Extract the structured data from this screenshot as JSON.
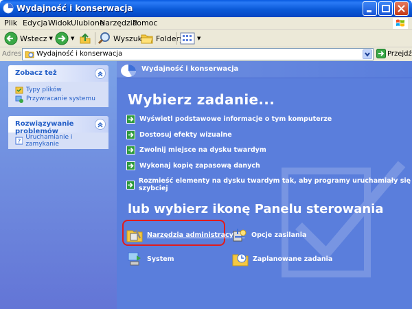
{
  "window": {
    "title": "Wydajność i konserwacja"
  },
  "menu": [
    "Plik",
    "Edycja",
    "Widok",
    "Ulubione",
    "Narzędzia",
    "Pomoc"
  ],
  "toolbar": {
    "back_label": "Wstecz",
    "search_label": "Wyszukaj",
    "folders_label": "Foldery"
  },
  "address": {
    "label": "Adres",
    "value": "Wydajność i konserwacja",
    "go_label": "Przejdź"
  },
  "sidebar": {
    "see_also": {
      "title": "Zobacz też",
      "links": [
        "Typy plików",
        "Przywracanie systemu"
      ]
    },
    "troubleshoot": {
      "title": "Rozwiązywanie problemów",
      "links": [
        "Uruchamianie i zamykanie"
      ]
    }
  },
  "main": {
    "crumb_title": "Wydajność i konserwacja",
    "heading": "Wybierz zadanie...",
    "tasks": [
      "Wyświetl podstawowe informacje o tym komputerze",
      "Dostosuj efekty wizualne",
      "Zwolnij miejsce na dysku twardym",
      "Wykonaj kopię zapasową danych",
      "Rozmieść elementy na dysku twardym tak, aby programy uruchamiały się szybciej"
    ],
    "subheading": "lub wybierz ikonę Panelu sterowania",
    "icons": [
      {
        "label": "Narzędzia administracyjne"
      },
      {
        "label": "Opcje zasilania"
      },
      {
        "label": "System"
      },
      {
        "label": "Zaplanowane zadania"
      }
    ]
  },
  "colors": {
    "titlebar": "#0a5be0",
    "main_bg": "#5a7edc",
    "sidebar_link": "#215dc6",
    "highlight": "#e21b1b"
  }
}
